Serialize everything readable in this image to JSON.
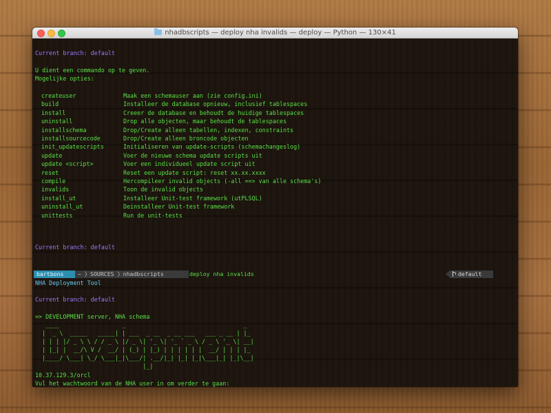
{
  "window": {
    "title": "nhadbscripts — deploy nha invalids — deploy — Python — 130×41"
  },
  "terminal": {
    "branch_line_1": "Current branch: default",
    "instruction": "U dient een commando op te geven.",
    "options_header": "Mogelijke opties:",
    "options": [
      {
        "name": "createuser",
        "desc": "Maak een schemauser aan (zie config.ini)"
      },
      {
        "name": "build",
        "desc": "Installeer de database opnieuw, inclusief tablespaces"
      },
      {
        "name": "install",
        "desc": "Creeer de database en behoudt de huidige tablespaces"
      },
      {
        "name": "uninstall",
        "desc": "Drop alle objecten, maar behoudt de tablespaces"
      },
      {
        "name": "installschema",
        "desc": "Drop/Create alleen tabellen, indexen, constraints"
      },
      {
        "name": "installsourcecode",
        "desc": "Drop/Create alleen broncode objecten"
      },
      {
        "name": "init_updatescripts",
        "desc": "Initialiseren van update-scripts (schemachangeslog)"
      },
      {
        "name": "update",
        "desc": "Voer de nieuwe schema update scripts uit"
      },
      {
        "name": "update <script>",
        "desc": "Voer een individueel update script uit"
      },
      {
        "name": "reset",
        "desc": "Reset een update script: reset xx.xx.xxxx"
      },
      {
        "name": "compile",
        "desc": "Hercompileer invalid objects (-all ==> van alle schema's)"
      },
      {
        "name": "invalids",
        "desc": "Toon de invalid objects"
      },
      {
        "name": "install_ut",
        "desc": "Installeer Unit-test framework (utPLSQL)"
      },
      {
        "name": "uninstall_ut",
        "desc": "Deinstalleer Unit-test framework"
      },
      {
        "name": "unittests",
        "desc": "Run de unit-tests"
      }
    ],
    "branch_line_2": "Current branch: default",
    "prompt": {
      "user": "bartbons",
      "path": "~ 〉SOURCES 〉nhadbscripts",
      "command": "deploy nha invalids",
      "branch": "default"
    },
    "tool_name": "NHA Deployment Tool",
    "branch_line_3": "Current branch: default",
    "env_line": "=> DEVELOPMENT server, NHA schema",
    "ascii_art": "   ____                  _                                  _\n  |  _ \\  _____   _____| | ___  _ __  _ __ ___   ___ _ __ | |_\n  | | | |/ _ \\ \\ / / _ \\ |/ _ \\| '_ \\| '_ ` _ \\ / _ \\ '_ \\| __|\n  | |_| |  __/\\ V /  __/ | (_) | |_) | | | | | |  __/ | | | |_\n  |____/ \\___| \\_/ \\___|_|\\___/| .__/|_| |_| |_|\\___|_| |_|\\__|\n                               |_|",
    "connection": "10.37.129.3/orcl",
    "password_prompt": "Vul het wachtwoord van de NHA user in om verder te gaan:"
  }
}
